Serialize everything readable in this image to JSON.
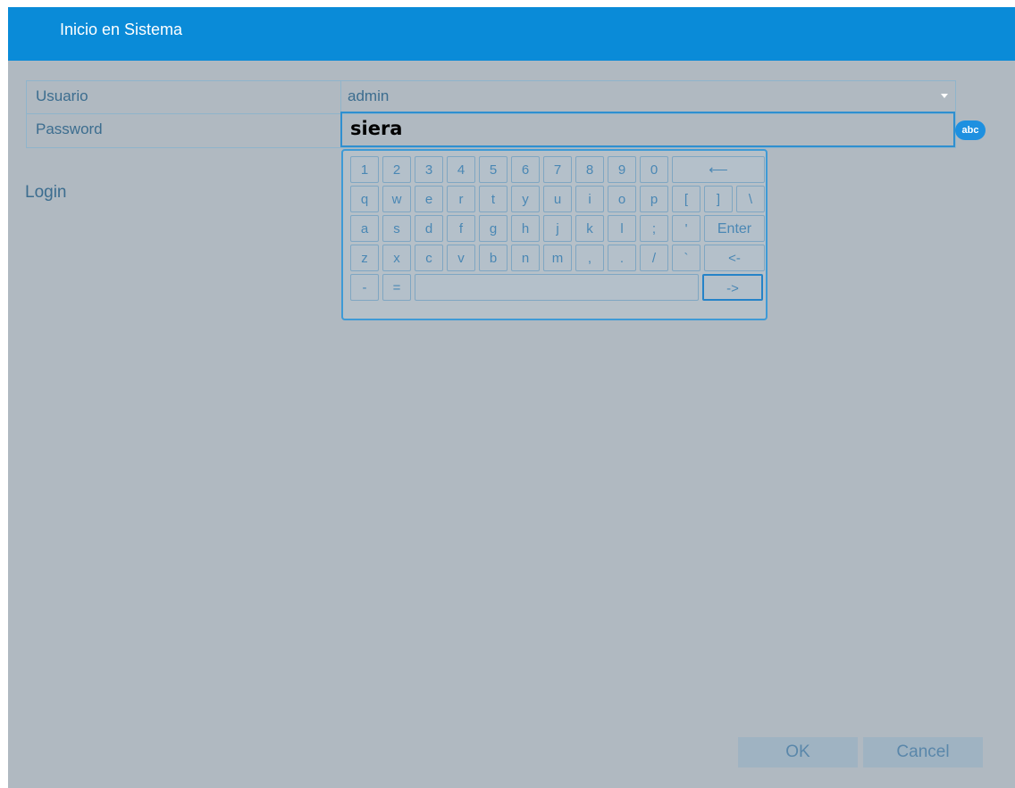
{
  "window": {
    "title": "Inicio en Sistema"
  },
  "form": {
    "user_label": "Usuario",
    "user_value": "admin",
    "password_label": "Password",
    "password_value": "siera",
    "input_mode_badge": "abc"
  },
  "login_label": "Login",
  "keyboard": {
    "rows": [
      [
        "1",
        "2",
        "3",
        "4",
        "5",
        "6",
        "7",
        "8",
        "9",
        "0",
        "⟵"
      ],
      [
        "q",
        "w",
        "e",
        "r",
        "t",
        "y",
        "u",
        "i",
        "o",
        "p",
        "[",
        "]",
        "\\"
      ],
      [
        "a",
        "s",
        "d",
        "f",
        "g",
        "h",
        "j",
        "k",
        "l",
        ";",
        "'",
        "Enter"
      ],
      [
        "z",
        "x",
        "c",
        "v",
        "b",
        "n",
        "m",
        ",",
        ".",
        "/",
        "`",
        "<-"
      ],
      [
        "-",
        "=",
        "",
        "->"
      ]
    ]
  },
  "buttons": {
    "ok": "OK",
    "cancel": "Cancel"
  }
}
